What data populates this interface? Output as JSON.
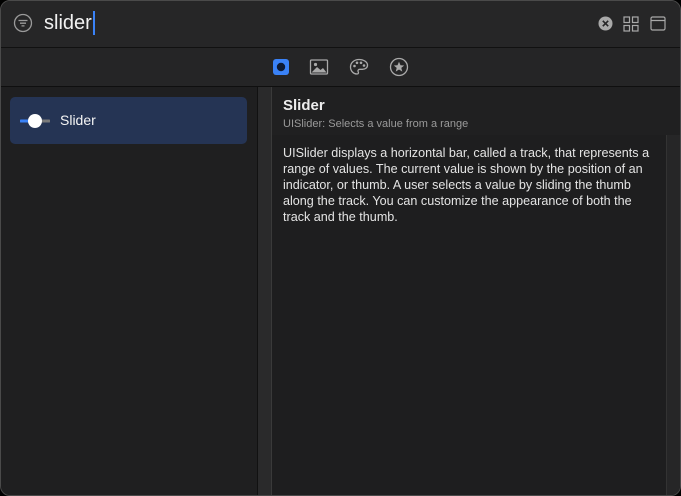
{
  "search": {
    "query": "slider"
  },
  "toolbar_icons": [
    "filter-icon",
    "clear-search-icon",
    "grid-view-icon",
    "panel-toggle-icon"
  ],
  "tabs": [
    {
      "name": "objects",
      "icon": "square-dot-icon",
      "active": true
    },
    {
      "name": "media",
      "icon": "image-icon"
    },
    {
      "name": "colors",
      "icon": "palette-icon"
    },
    {
      "name": "snippets",
      "icon": "star-circle-icon"
    }
  ],
  "results": [
    {
      "label": "Slider",
      "icon": "slider-icon",
      "selected": true
    }
  ],
  "detail": {
    "title": "Slider",
    "subtitle": "UISlider: Selects a value from a range",
    "description": "UISlider displays a horizontal bar, called a track, that represents a range of values. The current value is shown by the position of an indicator, or thumb. A user selects a value by sliding the thumb along the track. You can customize the appearance of both the track and the thumb."
  },
  "colors": {
    "accent": "#3a82f7",
    "selection": "#253454",
    "window": "#1e1e1f"
  }
}
